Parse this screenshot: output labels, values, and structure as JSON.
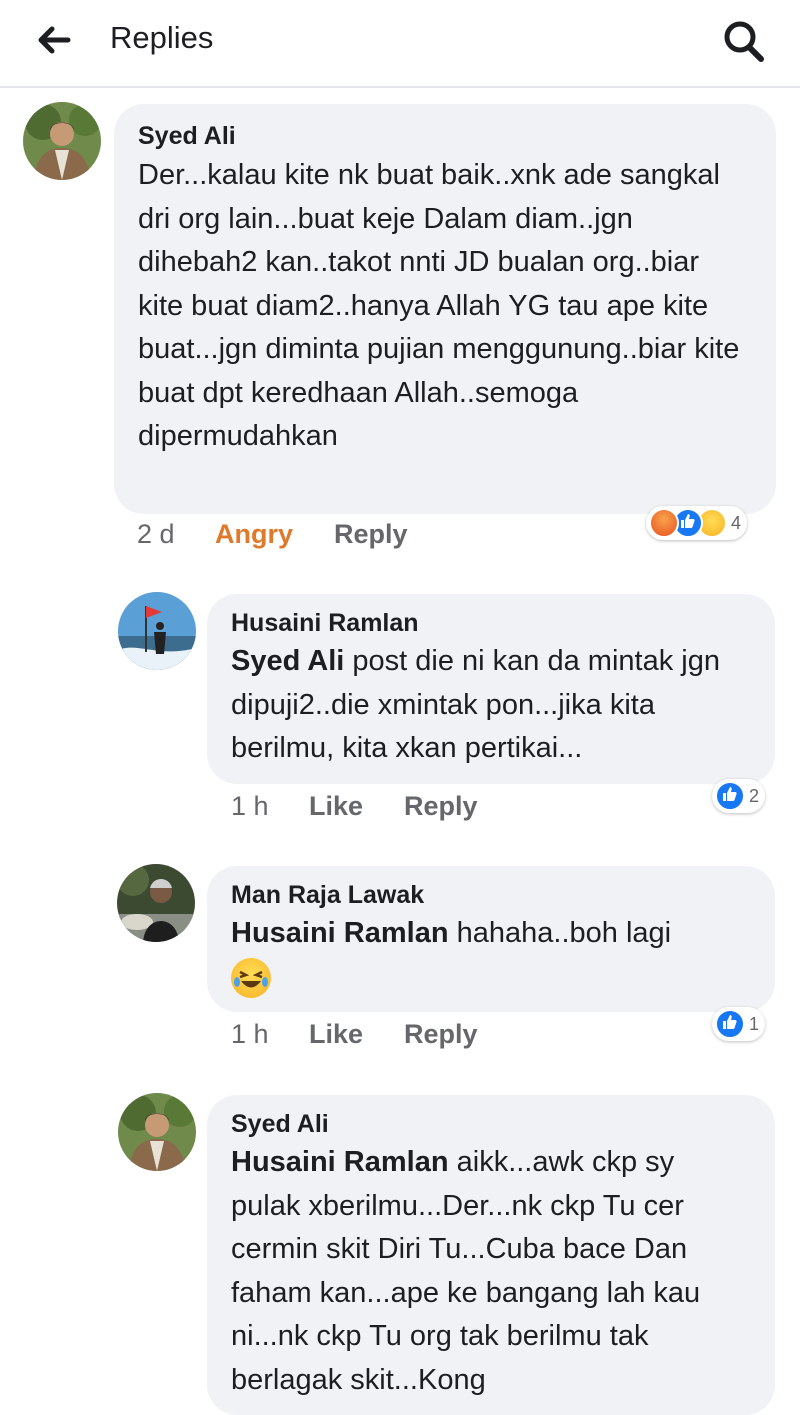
{
  "header": {
    "title": "Replies",
    "back_icon": "arrow-left-icon",
    "search_icon": "search-icon"
  },
  "comments": [
    {
      "author": "Syed Ali",
      "mention": "",
      "text": "Der...kalau kite nk buat baik..xnk ade sangkal dri org lain...buat keje Dalam diam..jgn dihebah2 kan..takot nnti JD bualan org..biar kite buat diam2..hanya Allah YG tau ape kite buat...jgn diminta pujian menggunung..biar kite buat dpt keredhaan Allah..semoga dipermudahkan",
      "time": "2 d",
      "reaction_action": "Angry",
      "reply_label": "Reply",
      "reaction_count": "4"
    },
    {
      "author": "Husaini Ramlan",
      "mention": "Syed Ali",
      "text": " post die ni kan da mintak jgn dipuji2..die xmintak pon...jika kita berilmu, kita xkan pertikai...",
      "time": "1 h",
      "like_label": "Like",
      "reply_label": "Reply",
      "reaction_count": "2"
    },
    {
      "author": "Man Raja Lawak",
      "mention": "Husaini Ramlan",
      "text": " hahaha..boh lagi",
      "time": "1 h",
      "like_label": "Like",
      "reply_label": "Reply",
      "reaction_count": "1"
    },
    {
      "author": "Syed Ali",
      "mention": "Husaini Ramlan",
      "text": " aikk...awk ckp sy pulak xberilmu...Der...nk ckp Tu cer cermin skit Diri Tu...Cuba bace Dan faham kan...ape ke bangang lah kau ni...nk ckp Tu org tak berilmu tak berlagak skit...Kong"
    }
  ],
  "colors": {
    "bubble": "#f0f2f5",
    "angry": "#e07a2b",
    "like_blue": "#1877f2",
    "meta": "#65676b"
  }
}
